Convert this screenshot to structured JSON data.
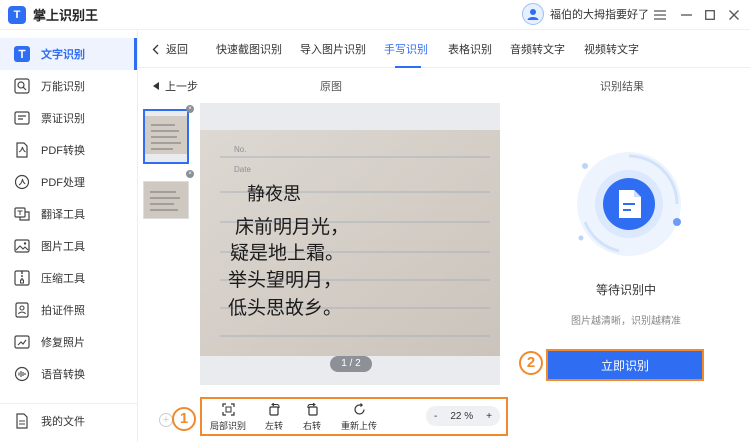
{
  "app": {
    "title": "掌上识别王",
    "logo_text": "T"
  },
  "user": {
    "name": "福伯的大拇指要好了"
  },
  "window": {
    "menu_icon": "menu-icon",
    "minimize_icon": "minimize-icon",
    "maximize_icon": "maximize-icon",
    "close_icon": "close-icon"
  },
  "sidebar": {
    "items": [
      {
        "label": "文字识别",
        "icon": "text-recognition-icon",
        "active": true
      },
      {
        "label": "万能识别",
        "icon": "universal-scan-icon"
      },
      {
        "label": "票证识别",
        "icon": "ticket-icon"
      },
      {
        "label": "PDF转换",
        "icon": "pdf-convert-icon"
      },
      {
        "label": "PDF处理",
        "icon": "pdf-process-icon"
      },
      {
        "label": "翻译工具",
        "icon": "translate-icon"
      },
      {
        "label": "图片工具",
        "icon": "image-tool-icon"
      },
      {
        "label": "压缩工具",
        "icon": "compress-icon"
      },
      {
        "label": "拍证件照",
        "icon": "id-photo-icon"
      },
      {
        "label": "修复照片",
        "icon": "photo-repair-icon"
      },
      {
        "label": "语音转换",
        "icon": "voice-convert-icon"
      }
    ],
    "my_files": {
      "label": "我的文件",
      "icon": "file-icon"
    }
  },
  "tabs": {
    "back_label": "返回",
    "items": [
      {
        "label": "快速截图识别"
      },
      {
        "label": "导入图片识别"
      },
      {
        "label": "手写识别",
        "active": true
      },
      {
        "label": "表格识别"
      },
      {
        "label": "音频转文字"
      },
      {
        "label": "视频转文字"
      }
    ]
  },
  "editor": {
    "prev_step": "上一步",
    "original_title": "原图",
    "result_title": "识别结果",
    "page_indicator": "1 / 2",
    "photo_text": [
      "静夜思",
      "床前明月光，",
      "疑是地上霜。",
      "举头望明月，",
      "低头思故乡。"
    ],
    "photo_header": [
      "No.",
      "Date"
    ]
  },
  "toolbar": {
    "local_label": "局部识别",
    "rotate_left_label": "左转",
    "rotate_right_label": "右转",
    "reupload_label": "重新上传",
    "zoom_minus": "-",
    "zoom_value": "22 %",
    "zoom_plus": "+"
  },
  "annotations": {
    "one": "1",
    "two": "2"
  },
  "result": {
    "status": "等待识别中",
    "hint": "图片越清晰，识别越精准",
    "button": "立即识别"
  },
  "colors": {
    "accent": "#2f6df3",
    "highlight": "#f08a2c"
  }
}
